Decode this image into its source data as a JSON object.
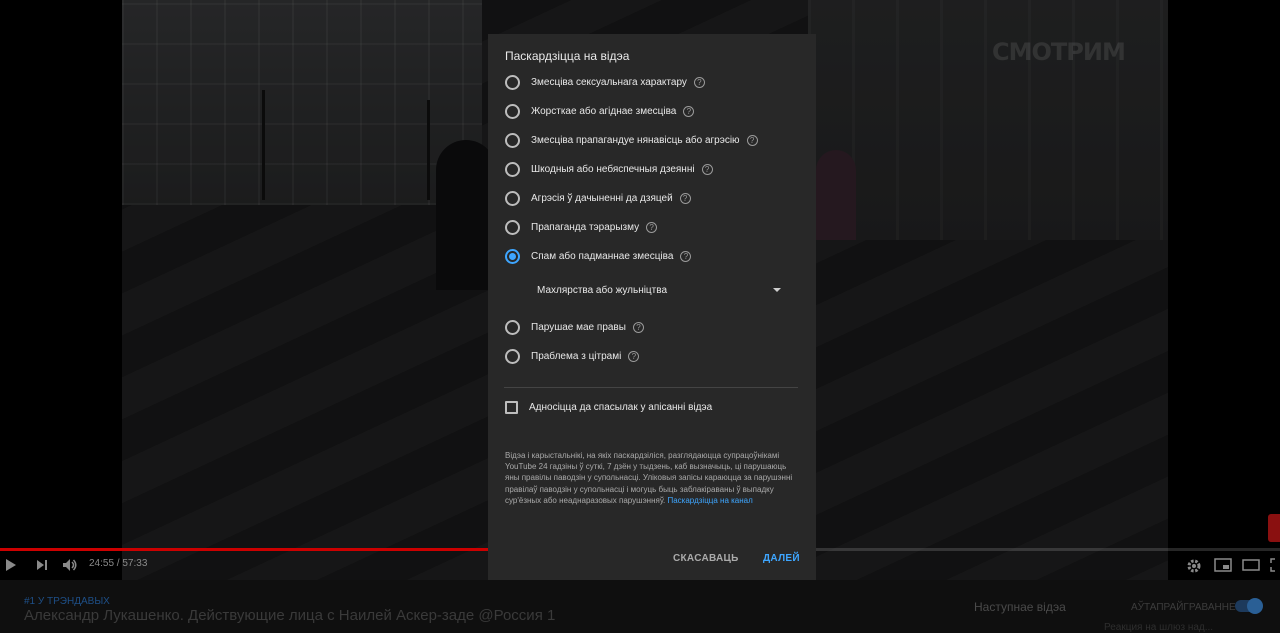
{
  "player": {
    "watermark": "СМОТРИМ",
    "time": "24:55 / 57:33",
    "progress_fraction": 0.433,
    "accent_color": "#cc0000"
  },
  "below": {
    "trend_tag": "#1 У ТРЭНДАВЫХ",
    "video_title": "Александр Лукашенко. Действующие лица с Наилей Аскер-заде @Россия 1",
    "next_label": "Наступнае відэа",
    "autoplay_label": "АЎТАПРАЙГРАВАННЕ",
    "partial_text": "Реакция на шлюз над..."
  },
  "dialog": {
    "title": "Паскардзіцца на відэа",
    "options": [
      {
        "label": "Змесціва сексуальнага характару",
        "checked": false
      },
      {
        "label": "Жорсткае або агіднае змесціва",
        "checked": false
      },
      {
        "label": "Змесціва прапагандуе нянавісць або агрэсію",
        "checked": false
      },
      {
        "label": "Шкодныя або небяспечныя дзеянні",
        "checked": false
      },
      {
        "label": "Агрэсія ў дачыненні да дзяцей",
        "checked": false
      },
      {
        "label": "Прапаганда тэрарызму",
        "checked": false
      },
      {
        "label": "Спам або падманнае змесціва",
        "checked": true
      },
      {
        "label": "Парушае мае правы",
        "checked": false
      },
      {
        "label": "Праблема з цітрамі",
        "checked": false
      }
    ],
    "help_glyph": "?",
    "subreason_selected": "Махлярства або жульніцтва",
    "timestamp_checkbox_label": "Адносіцца да спасылак у апісанні відэа",
    "disclaimer_text": "Відэа і карыстальнікі, на якіх паскардзіліся, разглядаюцца супрацоўнікамі YouTube 24 гадзіны ў суткі, 7 дзён у тыдзень, каб вызначыць, ці парушаюць яны правілы паводзін у супольнасці. Уліковыя запісы караюцца за парушэнні правілаў паводзін у супольнасці і могуць быць заблакіраваны ў выпадку сур'ёзных або неаднаразовых парушэнняў.",
    "report_channel_link": "Паскардзіцца на канал",
    "cancel_label": "СКАСАВАЦЬ",
    "next_label": "ДАЛЕЙ",
    "accent_color": "#3ea6ff"
  }
}
